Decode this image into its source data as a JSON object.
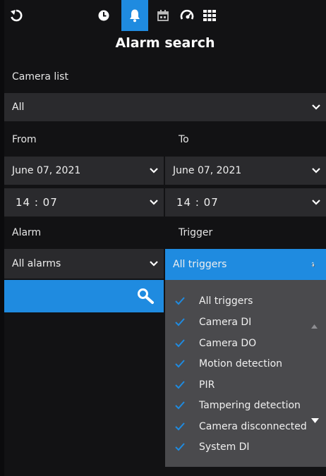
{
  "toolbar": {
    "icons": [
      "back-icon",
      "clock-icon",
      "bell-icon",
      "calendar-icon",
      "speedometer-icon",
      "grid-icon"
    ],
    "active": "bell-icon"
  },
  "page": {
    "title": "Alarm search"
  },
  "camera_list": {
    "label": "Camera list",
    "value": "All"
  },
  "from": {
    "label": "From",
    "date": "June 07, 2021",
    "time": "14 : 07"
  },
  "to": {
    "label": "To",
    "date": "June 07, 2021",
    "time": "14 : 07"
  },
  "alarm": {
    "label": "Alarm",
    "value": "All alarms"
  },
  "trigger": {
    "label": "Trigger",
    "value": "All triggers",
    "options": [
      {
        "label": "All triggers",
        "checked": true
      },
      {
        "label": "Camera DI",
        "checked": true
      },
      {
        "label": "Camera DO",
        "checked": true
      },
      {
        "label": "Motion detection",
        "checked": true
      },
      {
        "label": "PIR",
        "checked": true
      },
      {
        "label": "Tampering detection",
        "checked": true
      },
      {
        "label": "Camera disconnected",
        "checked": true
      },
      {
        "label": "System DI",
        "checked": true
      }
    ]
  },
  "colors": {
    "accent": "#1f8be0",
    "field": "#2a2a2d",
    "dropdown": "#4a4a4d"
  }
}
